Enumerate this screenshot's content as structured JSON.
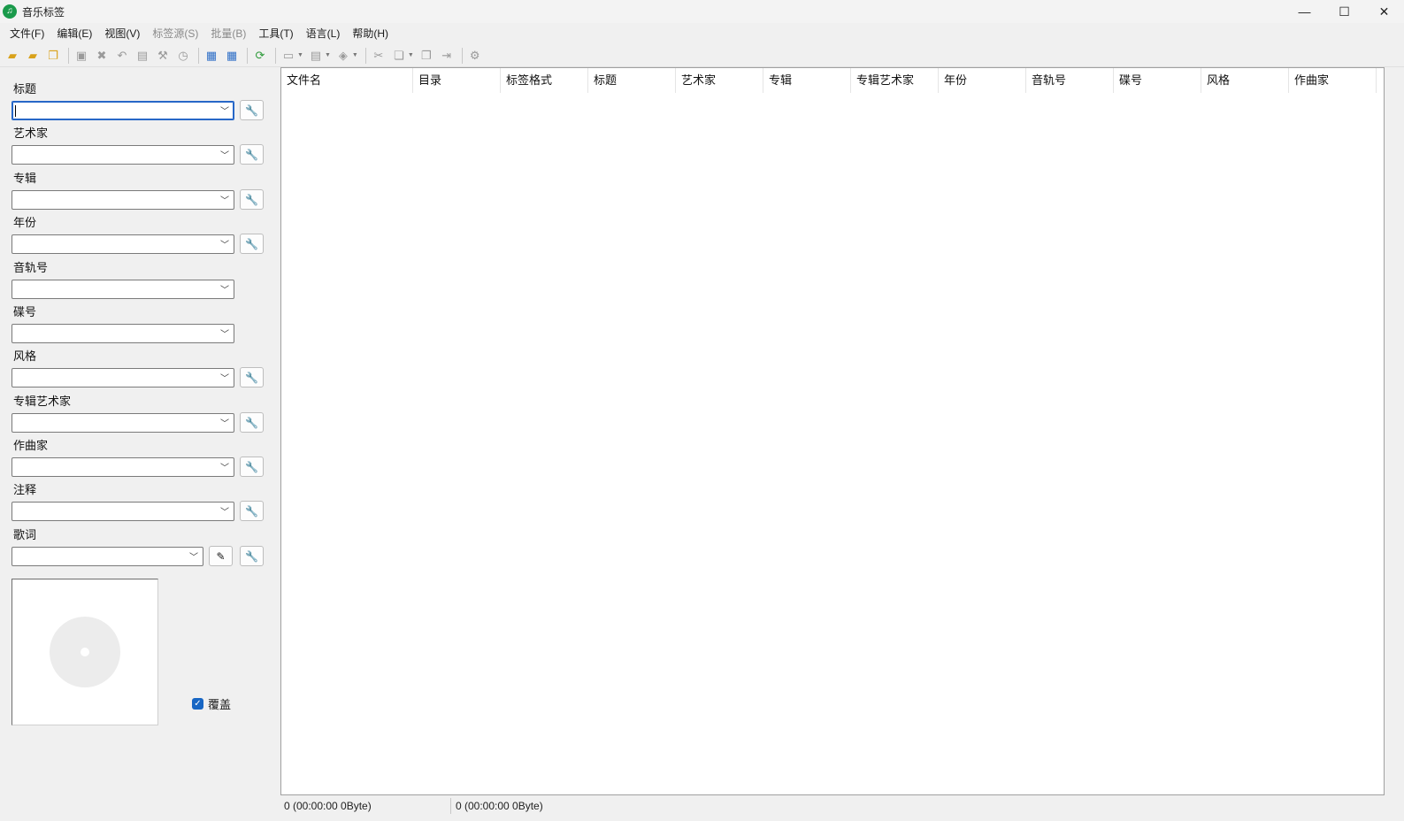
{
  "window": {
    "title": "音乐标签",
    "app_icon": "music-note-icon",
    "controls": {
      "minimize": "—",
      "maximize": "☐",
      "close": "✕"
    }
  },
  "menu": [
    {
      "label": "文件(F)",
      "enabled": true
    },
    {
      "label": "编辑(E)",
      "enabled": true
    },
    {
      "label": "视图(V)",
      "enabled": true
    },
    {
      "label": "标签源(S)",
      "enabled": false
    },
    {
      "label": "批量(B)",
      "enabled": false
    },
    {
      "label": "工具(T)",
      "enabled": true
    },
    {
      "label": "语言(L)",
      "enabled": true
    },
    {
      "label": "帮助(H)",
      "enabled": true
    }
  ],
  "toolbar": {
    "icons": [
      "open-folder-icon",
      "add-folder-icon",
      "open-files-icon",
      "save-icon",
      "delete-icon",
      "undo-icon",
      "book-icon",
      "wrench-icon",
      "history-icon",
      "grid-view-icon",
      "table-view-icon",
      "refresh-icon",
      "tag-icon",
      "text-tag-icon",
      "auto-tag-icon",
      "tools-icon",
      "copy-icon",
      "paste-icon",
      "move-icon",
      "settings-icon"
    ]
  },
  "fields": {
    "title": {
      "label": "标题",
      "value": ""
    },
    "artist": {
      "label": "艺术家",
      "value": ""
    },
    "album": {
      "label": "专辑",
      "value": ""
    },
    "year": {
      "label": "年份",
      "value": ""
    },
    "track": {
      "label": "音轨号",
      "value": ""
    },
    "disc": {
      "label": "碟号",
      "value": ""
    },
    "genre": {
      "label": "风格",
      "value": ""
    },
    "album_artist": {
      "label": "专辑艺术家",
      "value": ""
    },
    "composer": {
      "label": "作曲家",
      "value": ""
    },
    "comment": {
      "label": "注释",
      "value": ""
    },
    "lyrics": {
      "label": "歌词",
      "value": ""
    }
  },
  "overwrite": {
    "label": "覆盖",
    "checked": true
  },
  "columns": [
    "文件名",
    "目录",
    "标签格式",
    "标题",
    "艺术家",
    "专辑",
    "专辑艺术家",
    "年份",
    "音轨号",
    "碟号",
    "风格",
    "作曲家"
  ],
  "status": {
    "left": "0 (00:00:00 0Byte)",
    "right": "0 (00:00:00 0Byte)"
  }
}
